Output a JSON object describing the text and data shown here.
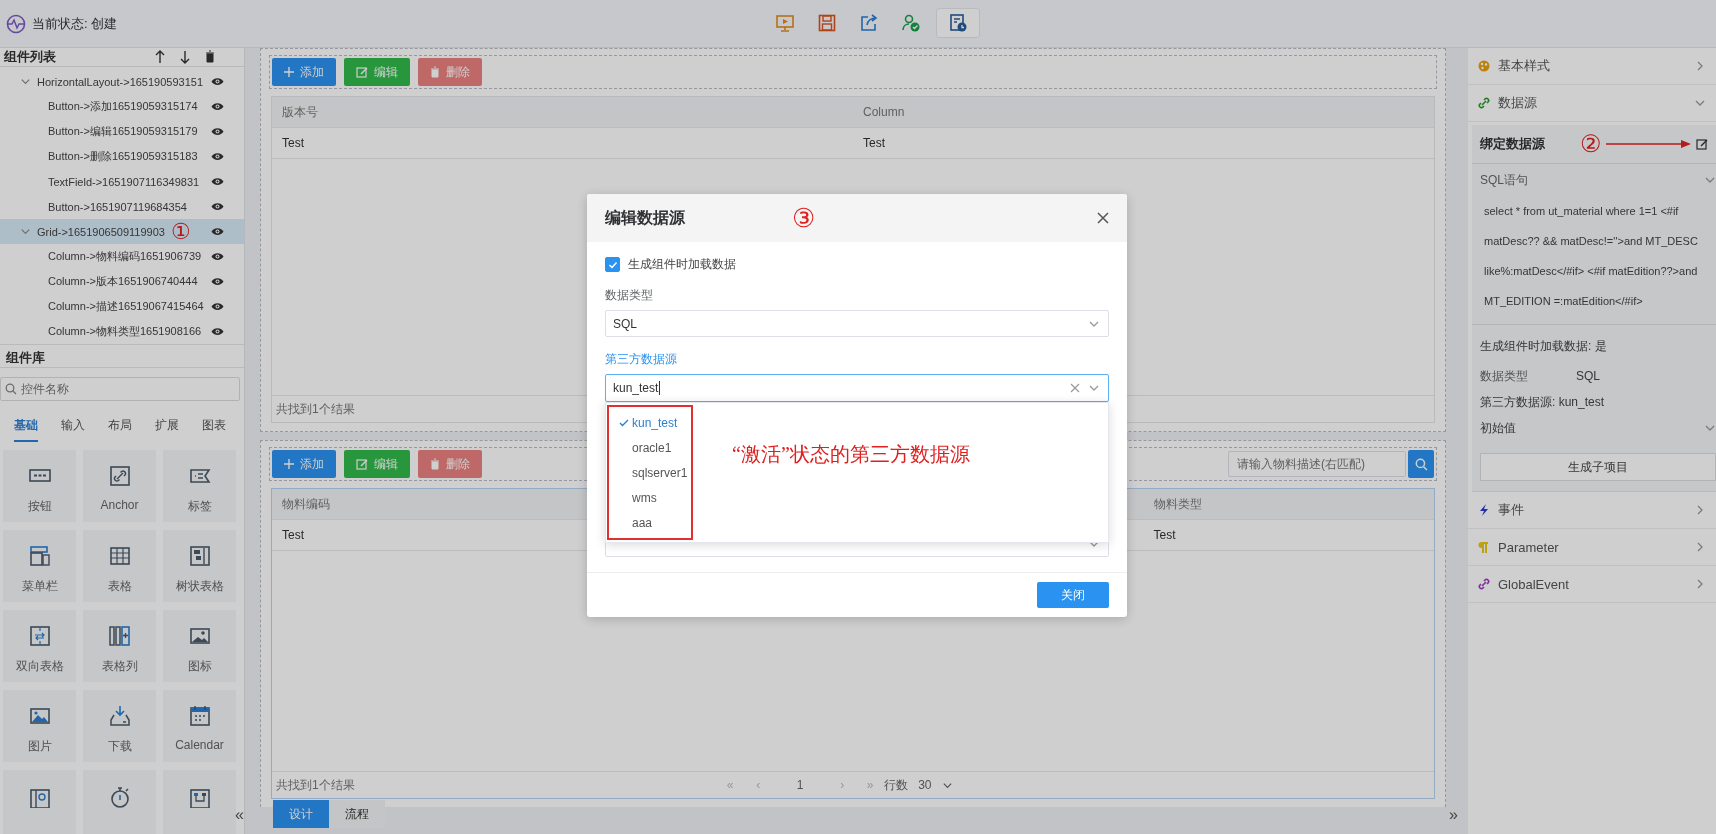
{
  "header": {
    "status": "当前状态: 创建"
  },
  "toolbar": [
    {
      "kind": "preview",
      "selected": false
    },
    {
      "kind": "save",
      "selected": false
    },
    {
      "kind": "share",
      "selected": false
    },
    {
      "kind": "publish",
      "selected": false
    },
    {
      "kind": "history",
      "selected": true
    }
  ],
  "component_list": {
    "title": "组件列表",
    "tree": [
      {
        "label": "HorizontalLayout->165190593151",
        "expanded": true,
        "selected": false,
        "children": [
          {
            "label": "Button->添加16519059315174",
            "selected": false
          },
          {
            "label": "Button->编辑16519059315179",
            "selected": false
          },
          {
            "label": "Button->删除16519059315183",
            "selected": false
          },
          {
            "label": "TextField->1651907116349831",
            "selected": false
          },
          {
            "label": "Button->1651907119684354",
            "selected": false
          }
        ]
      },
      {
        "label": "Grid->1651906509119903",
        "expanded": true,
        "selected": true,
        "mark": "①",
        "children": [
          {
            "label": "Column->物料编码1651906739",
            "selected": false
          },
          {
            "label": "Column->版本1651906740444",
            "selected": false
          },
          {
            "label": "Column->描述16519067415464",
            "selected": false
          },
          {
            "label": "Column->物料类型1651908166",
            "selected": false
          }
        ]
      }
    ]
  },
  "component_library": {
    "title": "组件库",
    "search": {
      "placeholder": "控件名称"
    },
    "tabs": [
      {
        "label": "基础",
        "selected": true
      },
      {
        "label": "输入",
        "selected": false
      },
      {
        "label": "布局",
        "selected": false
      },
      {
        "label": "扩展",
        "selected": false
      },
      {
        "label": "图表",
        "selected": false
      }
    ],
    "items": [
      {
        "label": "按钮",
        "kind": "btn"
      },
      {
        "label": "Anchor",
        "kind": "anchor"
      },
      {
        "label": "标签",
        "kind": "tag"
      },
      {
        "label": "菜单栏",
        "kind": "menubar"
      },
      {
        "label": "表格",
        "kind": "table"
      },
      {
        "label": "树状表格",
        "kind": "treetable"
      },
      {
        "label": "双向表格",
        "kind": "crosstable"
      },
      {
        "label": "表格列",
        "kind": "column"
      },
      {
        "label": "图标",
        "kind": "iconpic"
      },
      {
        "label": "图片",
        "kind": "picture"
      },
      {
        "label": "下载",
        "kind": "download"
      },
      {
        "label": "Calendar",
        "kind": "calendar"
      },
      {
        "kind": "doc"
      },
      {
        "kind": "timer"
      },
      {
        "kind": "flow"
      }
    ]
  },
  "canvas": {
    "sections": [
      {
        "buttons": [
          {
            "label": "添加",
            "kind": "add"
          },
          {
            "label": "编辑",
            "kind": "edit"
          },
          {
            "label": "删除",
            "kind": "delete"
          }
        ],
        "columns": [
          {
            "label": "版本号"
          },
          {
            "label": "Column"
          }
        ],
        "rows": [
          [
            "Test",
            "Test"
          ]
        ],
        "footer": "共找到1个结果"
      },
      {
        "buttons": [
          {
            "label": "添加",
            "kind": "add"
          },
          {
            "label": "编辑",
            "kind": "edit"
          },
          {
            "label": "删除",
            "kind": "delete"
          }
        ],
        "search": {
          "placeholder": "请输入物料描述(右匹配)"
        },
        "columns": [
          {
            "label": "物料编码"
          },
          {
            "label": "物料类型"
          }
        ],
        "rows": [
          [
            "Test",
            "Test"
          ]
        ],
        "footer": "共找到1个结果",
        "pagination": {
          "first": "«",
          "prev": "‹",
          "page": "1",
          "next": "›",
          "last": "»",
          "rows_label": "行数",
          "rows": "30"
        }
      }
    ],
    "collapse_left": "«",
    "collapse_right": "»",
    "tabs": [
      {
        "label": "设计",
        "selected": true
      },
      {
        "label": "流程",
        "selected": false
      }
    ]
  },
  "properties": {
    "sections": [
      {
        "label": "基本样式",
        "kind": "style",
        "expanded": false
      },
      {
        "label": "数据源",
        "kind": "datasource",
        "expanded": true
      }
    ],
    "binding": {
      "title": "绑定数据源",
      "mark": "②",
      "sql_label": "SQL语句",
      "sql": "select * from ut_material where 1=1 <#if matDesc?? && matDesc!=''>and MT_DESC like%:matDesc</#if> <#if matEdition??>and MT_EDITION =:matEdition</#if>",
      "load_on_create": "生成组件时加载数据:  是",
      "data_type_label": "数据类型",
      "data_type": "SQL",
      "third_party": "第三方数据源:  kun_test",
      "initial_label": "初始值",
      "generate_button": "生成子项目"
    },
    "more_sections": [
      {
        "label": "事件",
        "kind": "event",
        "expanded": false
      },
      {
        "label": "Parameter",
        "kind": "parameter",
        "expanded": false
      },
      {
        "label": "GlobalEvent",
        "kind": "global",
        "expanded": false
      }
    ]
  },
  "dialog": {
    "title": "编辑数据源",
    "title_mark": "③",
    "load_checkbox": {
      "label": "生成组件时加载数据",
      "checked": true
    },
    "data_type": {
      "label": "数据类型",
      "value": "SQL"
    },
    "third_party": {
      "label": "第三方数据源",
      "value": "kun_test"
    },
    "options": [
      {
        "label": "kun_test",
        "selected": true
      },
      {
        "label": "oracle1",
        "selected": false
      },
      {
        "label": "sqlserver1",
        "selected": false
      },
      {
        "label": "wms",
        "selected": false
      },
      {
        "label": "aaa",
        "selected": false
      }
    ],
    "note": "“激活”状态的第三方数据源",
    "close_button": "关闭"
  }
}
